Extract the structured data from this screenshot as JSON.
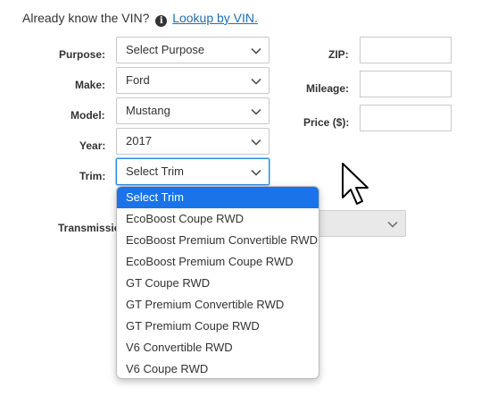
{
  "vin": {
    "prompt": "Already know the VIN?",
    "link": "Lookup by VIN."
  },
  "fields": {
    "purpose": {
      "label": "Purpose:",
      "value": "Select Purpose"
    },
    "make": {
      "label": "Make:",
      "value": "Ford"
    },
    "model": {
      "label": "Model:",
      "value": "Mustang"
    },
    "year": {
      "label": "Year:",
      "value": "2017"
    },
    "trim": {
      "label": "Trim:",
      "value": "Select Trim"
    },
    "transmission": {
      "label": "Transmissio"
    },
    "zip": {
      "label": "ZIP:",
      "value": ""
    },
    "mileage": {
      "label": "Mileage:",
      "value": ""
    },
    "price": {
      "label": "Price ($):",
      "value": ""
    }
  },
  "trim_options": [
    "Select Trim",
    "EcoBoost Coupe RWD",
    "EcoBoost Premium Convertible RWD",
    "EcoBoost Premium Coupe RWD",
    "GT Coupe RWD",
    "GT Premium Convertible RWD",
    "GT Premium Coupe RWD",
    "V6 Convertible RWD",
    "V6 Coupe RWD"
  ],
  "colors": {
    "link": "#1a6fb5",
    "selected_option": "#1a73e8",
    "focus_border": "#2b8ae0"
  }
}
